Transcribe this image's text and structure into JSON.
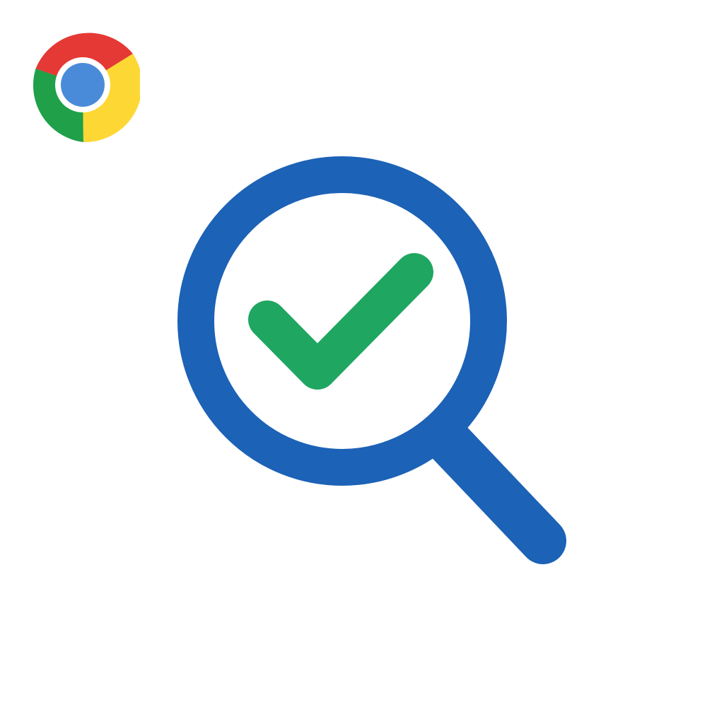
{
  "logo": {
    "icon": "chrome-icon",
    "colors": {
      "red": "#E53935",
      "yellow": "#FDD835",
      "green": "#1FA049",
      "center_blue": "#4A8BD9",
      "ring_white": "#ffffff"
    }
  },
  "emblem": {
    "icon": "magnifier-check-icon",
    "colors": {
      "lens": "#1C62B6",
      "check": "#1FA661",
      "background": "#ffffff"
    }
  }
}
